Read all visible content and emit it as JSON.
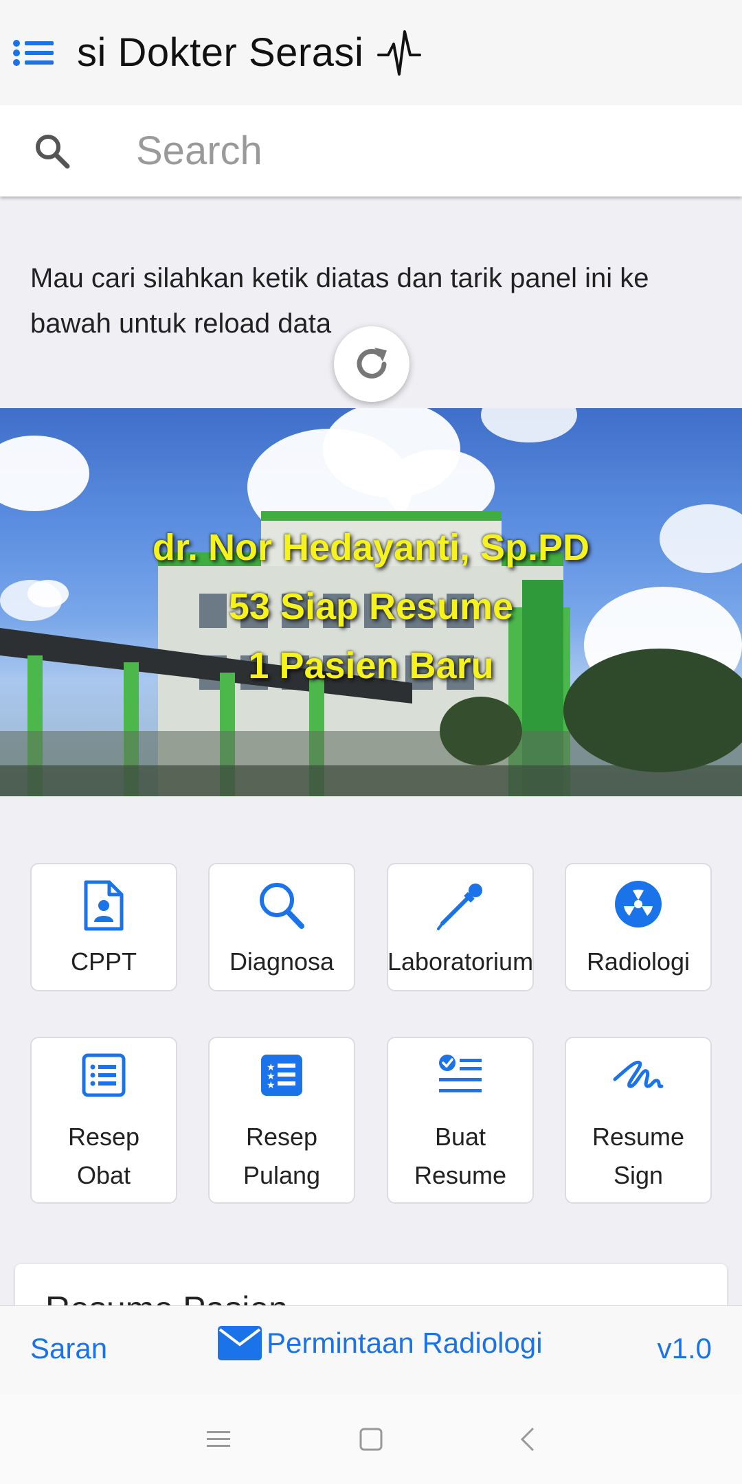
{
  "header": {
    "title": "si Dokter Serasi",
    "menu_icon": "list-icon",
    "title_icon": "heartbeat-icon"
  },
  "search": {
    "placeholder": "Search",
    "value": ""
  },
  "hint": {
    "text": "Mau cari silahkan ketik diatas dan tarik panel ini ke bawah untuk reload data"
  },
  "banner": {
    "doctor": "dr. Nor Hedayanti, Sp.PD",
    "resume_ready": "53 Siap Resume",
    "new_patients": "1 Pasien Baru"
  },
  "menu": {
    "cppt": "CPPT",
    "diagnosa": "Diagnosa",
    "laboratorium": "Laboratorium",
    "radiologi": "Radiologi",
    "resep_obat": [
      "Resep",
      "Obat"
    ],
    "resep_pulang": [
      "Resep",
      "Pulang"
    ],
    "buat_resume": [
      "Buat",
      "Resume"
    ],
    "resume_sign": [
      "Resume",
      "Sign"
    ]
  },
  "card": {
    "title": "Resume Pasien"
  },
  "toolbar": {
    "saran": "Saran",
    "radiologi_request": "Permintaan Radiologi",
    "version": "v1.0"
  },
  "colors": {
    "accent": "#1a73e8",
    "banner_text": "#f6f21c"
  }
}
